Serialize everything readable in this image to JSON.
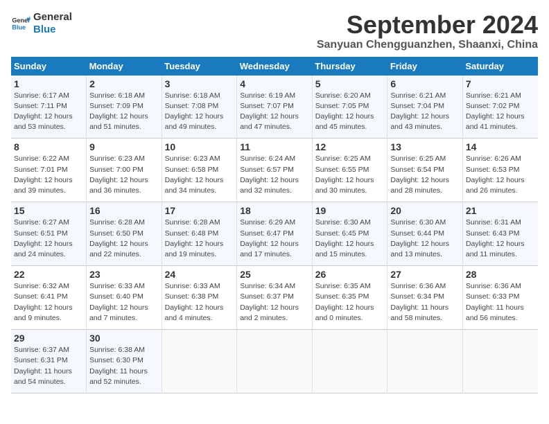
{
  "logo": {
    "line1": "General",
    "line2": "Blue"
  },
  "title": "September 2024",
  "subtitle": "Sanyuan Chengguanzhen, Shaanxi, China",
  "headers": [
    "Sunday",
    "Monday",
    "Tuesday",
    "Wednesday",
    "Thursday",
    "Friday",
    "Saturday"
  ],
  "weeks": [
    [
      {
        "day": "1",
        "sunrise": "6:17 AM",
        "sunset": "7:11 PM",
        "daylight": "12 hours and 53 minutes."
      },
      {
        "day": "2",
        "sunrise": "6:18 AM",
        "sunset": "7:09 PM",
        "daylight": "12 hours and 51 minutes."
      },
      {
        "day": "3",
        "sunrise": "6:18 AM",
        "sunset": "7:08 PM",
        "daylight": "12 hours and 49 minutes."
      },
      {
        "day": "4",
        "sunrise": "6:19 AM",
        "sunset": "7:07 PM",
        "daylight": "12 hours and 47 minutes."
      },
      {
        "day": "5",
        "sunrise": "6:20 AM",
        "sunset": "7:05 PM",
        "daylight": "12 hours and 45 minutes."
      },
      {
        "day": "6",
        "sunrise": "6:21 AM",
        "sunset": "7:04 PM",
        "daylight": "12 hours and 43 minutes."
      },
      {
        "day": "7",
        "sunrise": "6:21 AM",
        "sunset": "7:02 PM",
        "daylight": "12 hours and 41 minutes."
      }
    ],
    [
      {
        "day": "8",
        "sunrise": "6:22 AM",
        "sunset": "7:01 PM",
        "daylight": "12 hours and 39 minutes."
      },
      {
        "day": "9",
        "sunrise": "6:23 AM",
        "sunset": "7:00 PM",
        "daylight": "12 hours and 36 minutes."
      },
      {
        "day": "10",
        "sunrise": "6:23 AM",
        "sunset": "6:58 PM",
        "daylight": "12 hours and 34 minutes."
      },
      {
        "day": "11",
        "sunrise": "6:24 AM",
        "sunset": "6:57 PM",
        "daylight": "12 hours and 32 minutes."
      },
      {
        "day": "12",
        "sunrise": "6:25 AM",
        "sunset": "6:55 PM",
        "daylight": "12 hours and 30 minutes."
      },
      {
        "day": "13",
        "sunrise": "6:25 AM",
        "sunset": "6:54 PM",
        "daylight": "12 hours and 28 minutes."
      },
      {
        "day": "14",
        "sunrise": "6:26 AM",
        "sunset": "6:53 PM",
        "daylight": "12 hours and 26 minutes."
      }
    ],
    [
      {
        "day": "15",
        "sunrise": "6:27 AM",
        "sunset": "6:51 PM",
        "daylight": "12 hours and 24 minutes."
      },
      {
        "day": "16",
        "sunrise": "6:28 AM",
        "sunset": "6:50 PM",
        "daylight": "12 hours and 22 minutes."
      },
      {
        "day": "17",
        "sunrise": "6:28 AM",
        "sunset": "6:48 PM",
        "daylight": "12 hours and 19 minutes."
      },
      {
        "day": "18",
        "sunrise": "6:29 AM",
        "sunset": "6:47 PM",
        "daylight": "12 hours and 17 minutes."
      },
      {
        "day": "19",
        "sunrise": "6:30 AM",
        "sunset": "6:45 PM",
        "daylight": "12 hours and 15 minutes."
      },
      {
        "day": "20",
        "sunrise": "6:30 AM",
        "sunset": "6:44 PM",
        "daylight": "12 hours and 13 minutes."
      },
      {
        "day": "21",
        "sunrise": "6:31 AM",
        "sunset": "6:43 PM",
        "daylight": "12 hours and 11 minutes."
      }
    ],
    [
      {
        "day": "22",
        "sunrise": "6:32 AM",
        "sunset": "6:41 PM",
        "daylight": "12 hours and 9 minutes."
      },
      {
        "day": "23",
        "sunrise": "6:33 AM",
        "sunset": "6:40 PM",
        "daylight": "12 hours and 7 minutes."
      },
      {
        "day": "24",
        "sunrise": "6:33 AM",
        "sunset": "6:38 PM",
        "daylight": "12 hours and 4 minutes."
      },
      {
        "day": "25",
        "sunrise": "6:34 AM",
        "sunset": "6:37 PM",
        "daylight": "12 hours and 2 minutes."
      },
      {
        "day": "26",
        "sunrise": "6:35 AM",
        "sunset": "6:35 PM",
        "daylight": "12 hours and 0 minutes."
      },
      {
        "day": "27",
        "sunrise": "6:36 AM",
        "sunset": "6:34 PM",
        "daylight": "11 hours and 58 minutes."
      },
      {
        "day": "28",
        "sunrise": "6:36 AM",
        "sunset": "6:33 PM",
        "daylight": "11 hours and 56 minutes."
      }
    ],
    [
      {
        "day": "29",
        "sunrise": "6:37 AM",
        "sunset": "6:31 PM",
        "daylight": "11 hours and 54 minutes."
      },
      {
        "day": "30",
        "sunrise": "6:38 AM",
        "sunset": "6:30 PM",
        "daylight": "11 hours and 52 minutes."
      },
      null,
      null,
      null,
      null,
      null
    ]
  ]
}
